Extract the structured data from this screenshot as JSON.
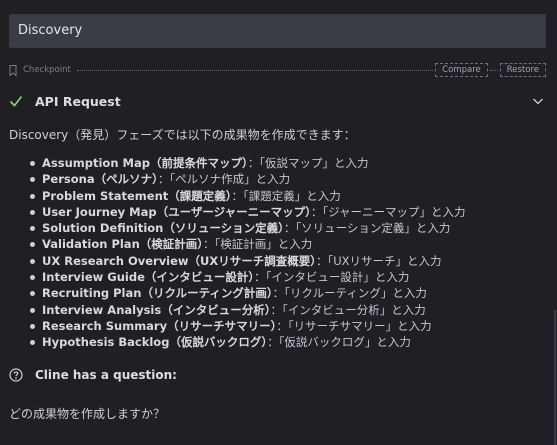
{
  "input": {
    "value": "Discovery"
  },
  "checkpoint": {
    "label": "Checkpoint",
    "compare_label": "Compare",
    "restore_label": "Restore"
  },
  "api_request": {
    "title": "API Request"
  },
  "message": {
    "intro": "Discovery（発見）フェーズでは以下の成果物を作成できます：",
    "items": [
      {
        "name": "Assumption Map（前提条件マップ）",
        "desc": "：「仮説マップ」と入力"
      },
      {
        "name": "Persona（ペルソナ）",
        "desc": "：「ペルソナ作成」と入力"
      },
      {
        "name": "Problem Statement（課題定義）",
        "desc": "：「課題定義」と入力"
      },
      {
        "name": "User Journey Map（ユーザージャーニーマップ）",
        "desc": "：「ジャーニーマップ」と入力"
      },
      {
        "name": "Solution Definition（ソリューション定義）",
        "desc": "：「ソリューション定義」と入力"
      },
      {
        "name": "Validation Plan（検証計画）",
        "desc": "：「検証計画」と入力"
      },
      {
        "name": "UX Research Overview（UXリサーチ調査概要）",
        "desc": "：「UXリサーチ」と入力"
      },
      {
        "name": "Interview Guide（インタビュー設計）",
        "desc": "：「インタビュー設計」と入力"
      },
      {
        "name": "Recruiting Plan（リクルーティング計画）",
        "desc": "：「リクルーティング」と入力"
      },
      {
        "name": "Interview Analysis（インタビュー分析）",
        "desc": "：「インタビュー分析」と入力"
      },
      {
        "name": "Research Summary（リサーチサマリー）",
        "desc": "：「リサーチサマリー」と入力"
      },
      {
        "name": "Hypothesis Backlog（仮説バックログ）",
        "desc": "：「仮説バックログ」と入力"
      }
    ]
  },
  "question": {
    "header": "Cline has a question:",
    "text": "どの成果物を作成しますか？"
  },
  "icons": {
    "checkpoint": "bookmark-icon",
    "api_status": "checkmark-icon",
    "expand": "chevron-down-icon",
    "question": "question-circle-icon"
  },
  "colors": {
    "background": "#1f1f24",
    "input_background": "#3a3b43",
    "text": "#cfd0d4",
    "check": "#8fd07a"
  }
}
